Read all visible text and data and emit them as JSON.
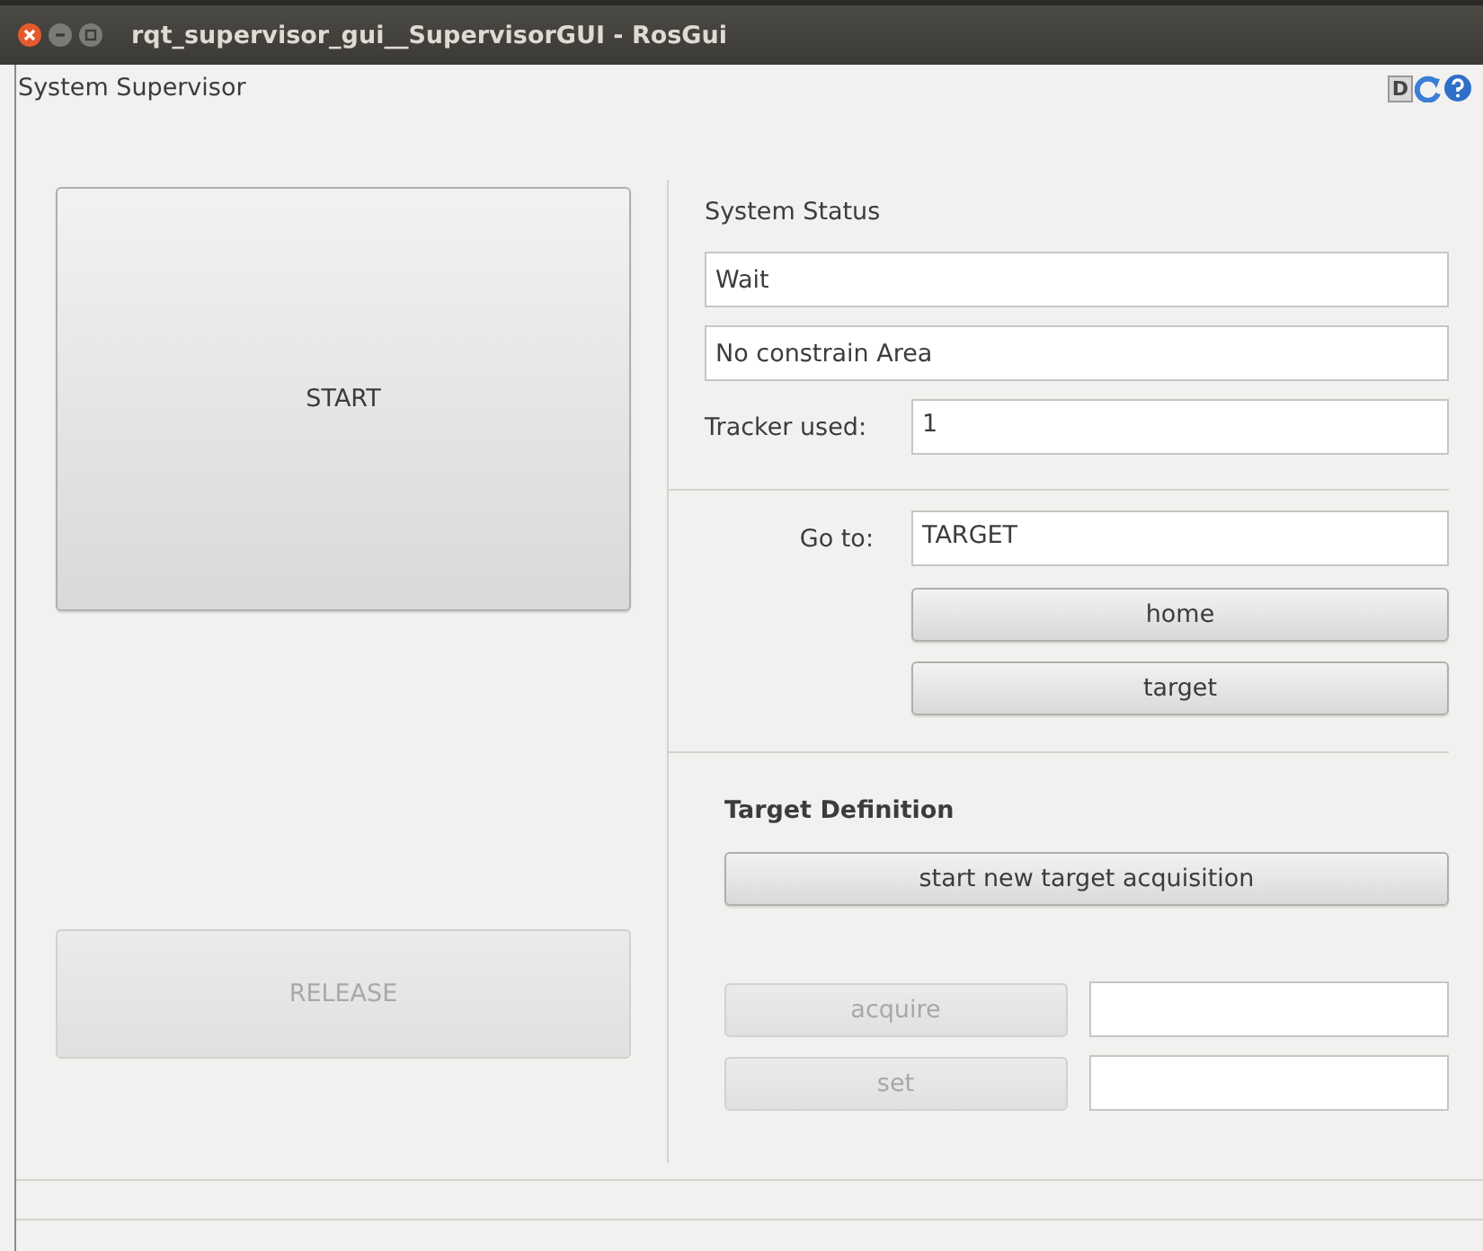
{
  "window": {
    "title": "rqt_supervisor_gui__SupervisorGUI - RosGui"
  },
  "plugin": {
    "title": "System Supervisor",
    "icons": [
      "D"
    ]
  },
  "left": {
    "start": {
      "label": "START",
      "disabled": false
    },
    "release": {
      "label": "RELEASE",
      "disabled": true
    }
  },
  "status": {
    "heading": "System Status",
    "state": "Wait",
    "area": "No constrain Area",
    "tracker_label": "Tracker used:",
    "tracker": "1"
  },
  "goto": {
    "label": "Go to:",
    "value": "TARGET",
    "buttons": [
      {
        "label": "home",
        "disabled": false
      },
      {
        "label": "target",
        "disabled": false
      }
    ]
  },
  "target_definition": {
    "heading": "Target Definition",
    "start": {
      "label": "start new target acquisition",
      "disabled": false
    },
    "rows": [
      {
        "label": "acquire",
        "disabled": true
      },
      {
        "label": "set",
        "disabled": true
      }
    ]
  }
}
